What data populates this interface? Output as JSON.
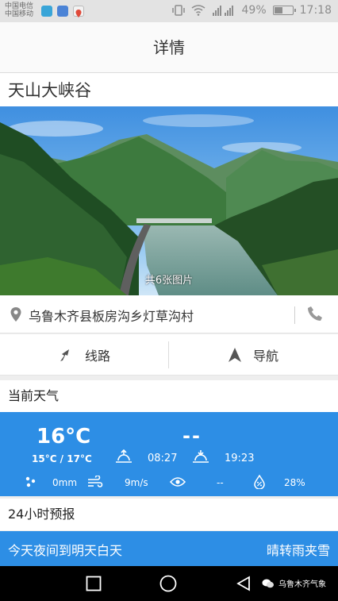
{
  "status_bar": {
    "carrier_line1": "中国电信",
    "carrier_line2": "中国移动",
    "battery_percent": "49%",
    "battery_level": 0.49,
    "time": "17:18"
  },
  "header": {
    "title": "详情"
  },
  "place": {
    "name": "天山大峡谷",
    "photo_count_label": "共6张图片",
    "address": "乌鲁木齐县板房沟乡灯草沟村"
  },
  "actions": {
    "route_label": "线路",
    "navigate_label": "导航"
  },
  "weather": {
    "section_title": "当前天气",
    "current_temp": "16°C",
    "temp_range": "15°C / 17°C",
    "current_value": "--",
    "sunrise": "08:27",
    "sunset": "19:23",
    "precipitation": "0mm",
    "wind": "9m/s",
    "visibility": "--",
    "humidity": "28%"
  },
  "forecast": {
    "section_title": "24小时预报",
    "period": "今天夜间到明天白天",
    "condition": "晴转雨夹雪"
  },
  "watermark": {
    "text": "乌鲁木齐气象"
  },
  "colors": {
    "accent": "#2d8ee5",
    "icon_gray": "#777777"
  },
  "icons": [
    "location-pin-icon",
    "phone-icon",
    "route-icon",
    "navigation-arrow-icon",
    "sunrise-icon",
    "sunset-icon",
    "rain-drops-icon",
    "wind-icon",
    "eye-icon",
    "humidity-icon",
    "back-icon",
    "home-icon",
    "recents-icon",
    "wechat-icon"
  ]
}
